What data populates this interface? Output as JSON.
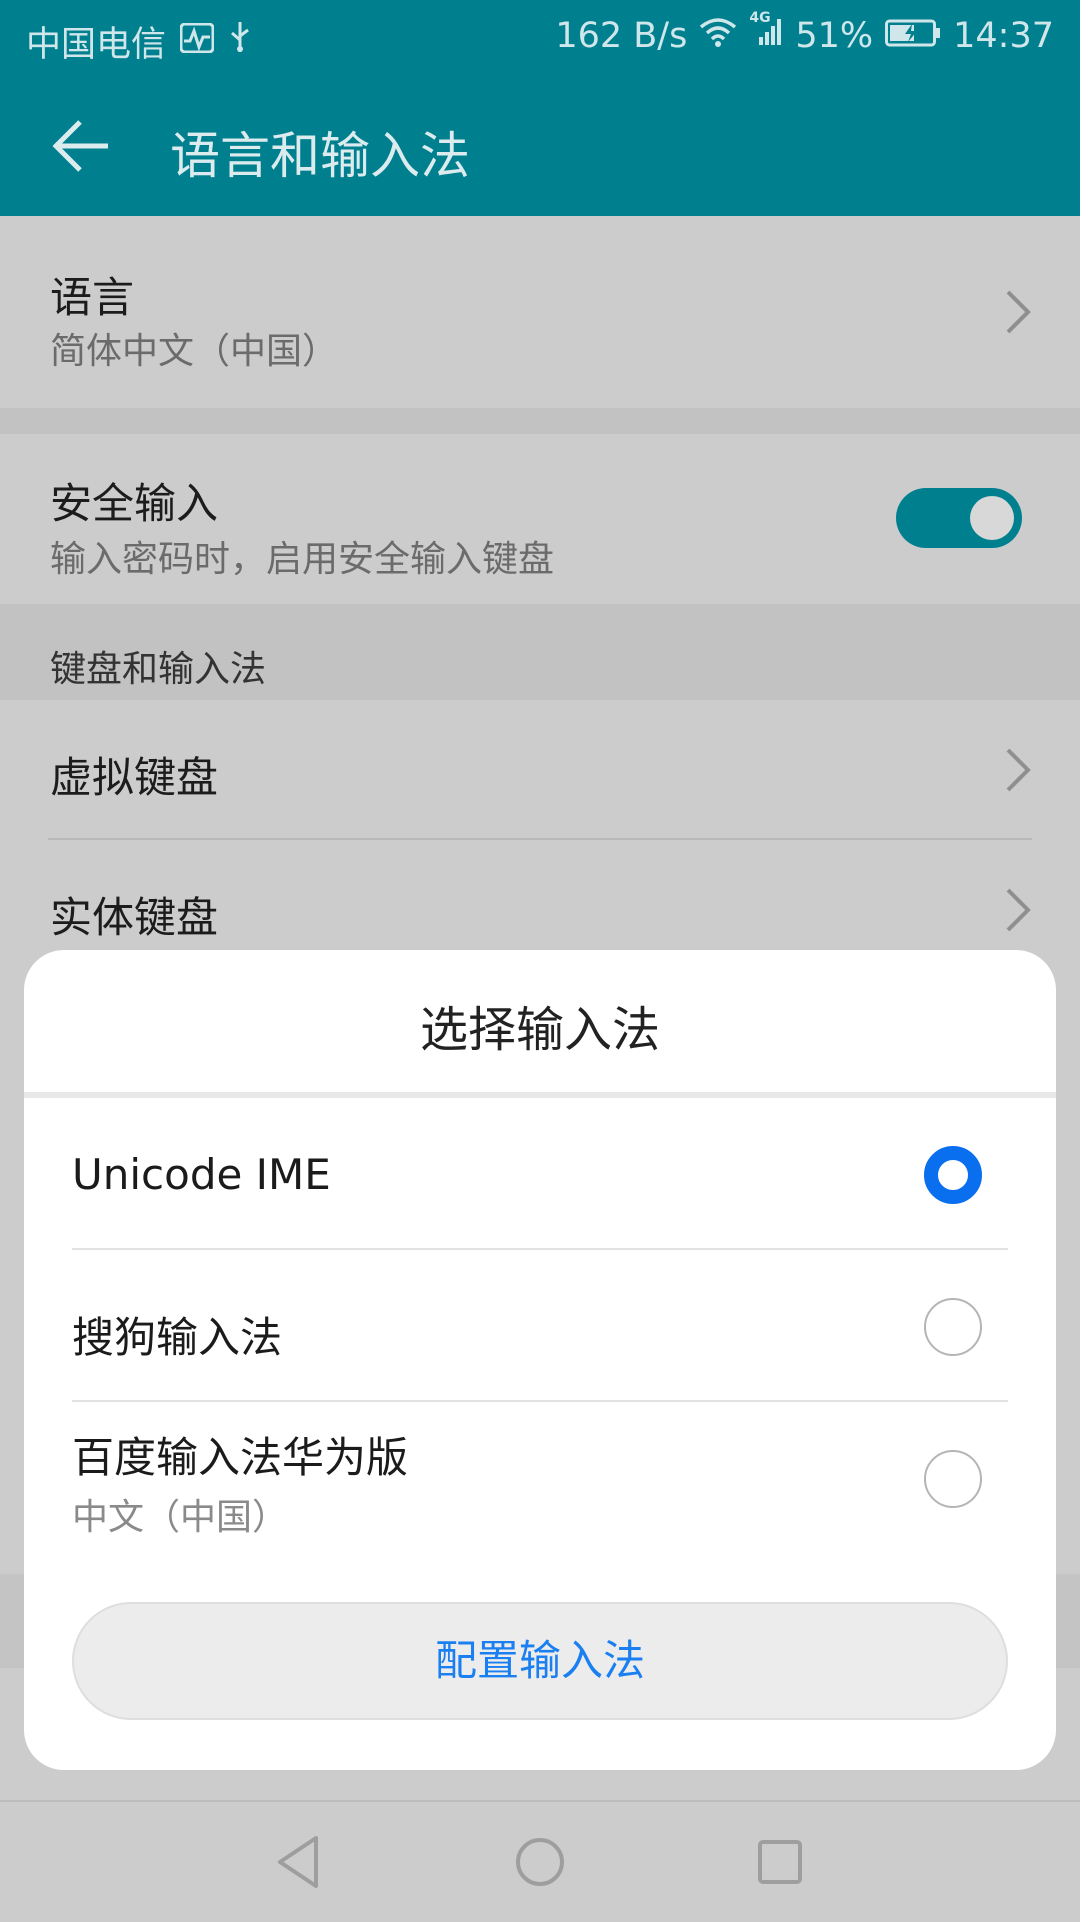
{
  "status_bar": {
    "carrier": "中国电信",
    "net_speed": "162 B/s",
    "network_type": "4G",
    "battery": "51%",
    "time": "14:37"
  },
  "app_bar": {
    "title": "语言和输入法"
  },
  "settings": {
    "language": {
      "label": "语言",
      "value": "简体中文（中国）"
    },
    "secure_input": {
      "label": "安全输入",
      "desc": "输入密码时，启用安全输入键盘",
      "enabled": true
    },
    "keyboard_section": {
      "title": "键盘和输入法"
    },
    "virtual_keyboard": {
      "label": "虚拟键盘"
    },
    "physical_keyboard": {
      "label": "实体键盘"
    }
  },
  "dialog": {
    "title": "选择输入法",
    "options": [
      {
        "label": "Unicode IME",
        "sub": "",
        "selected": true
      },
      {
        "label": "搜狗输入法",
        "sub": "",
        "selected": false
      },
      {
        "label": "百度输入法华为版",
        "sub": "中文（中国）",
        "selected": false
      }
    ],
    "configure_button": "配置输入法"
  },
  "colors": {
    "accent": "#00808f",
    "radio_selected": "#0a6fef",
    "link": "#1a7ff0"
  }
}
